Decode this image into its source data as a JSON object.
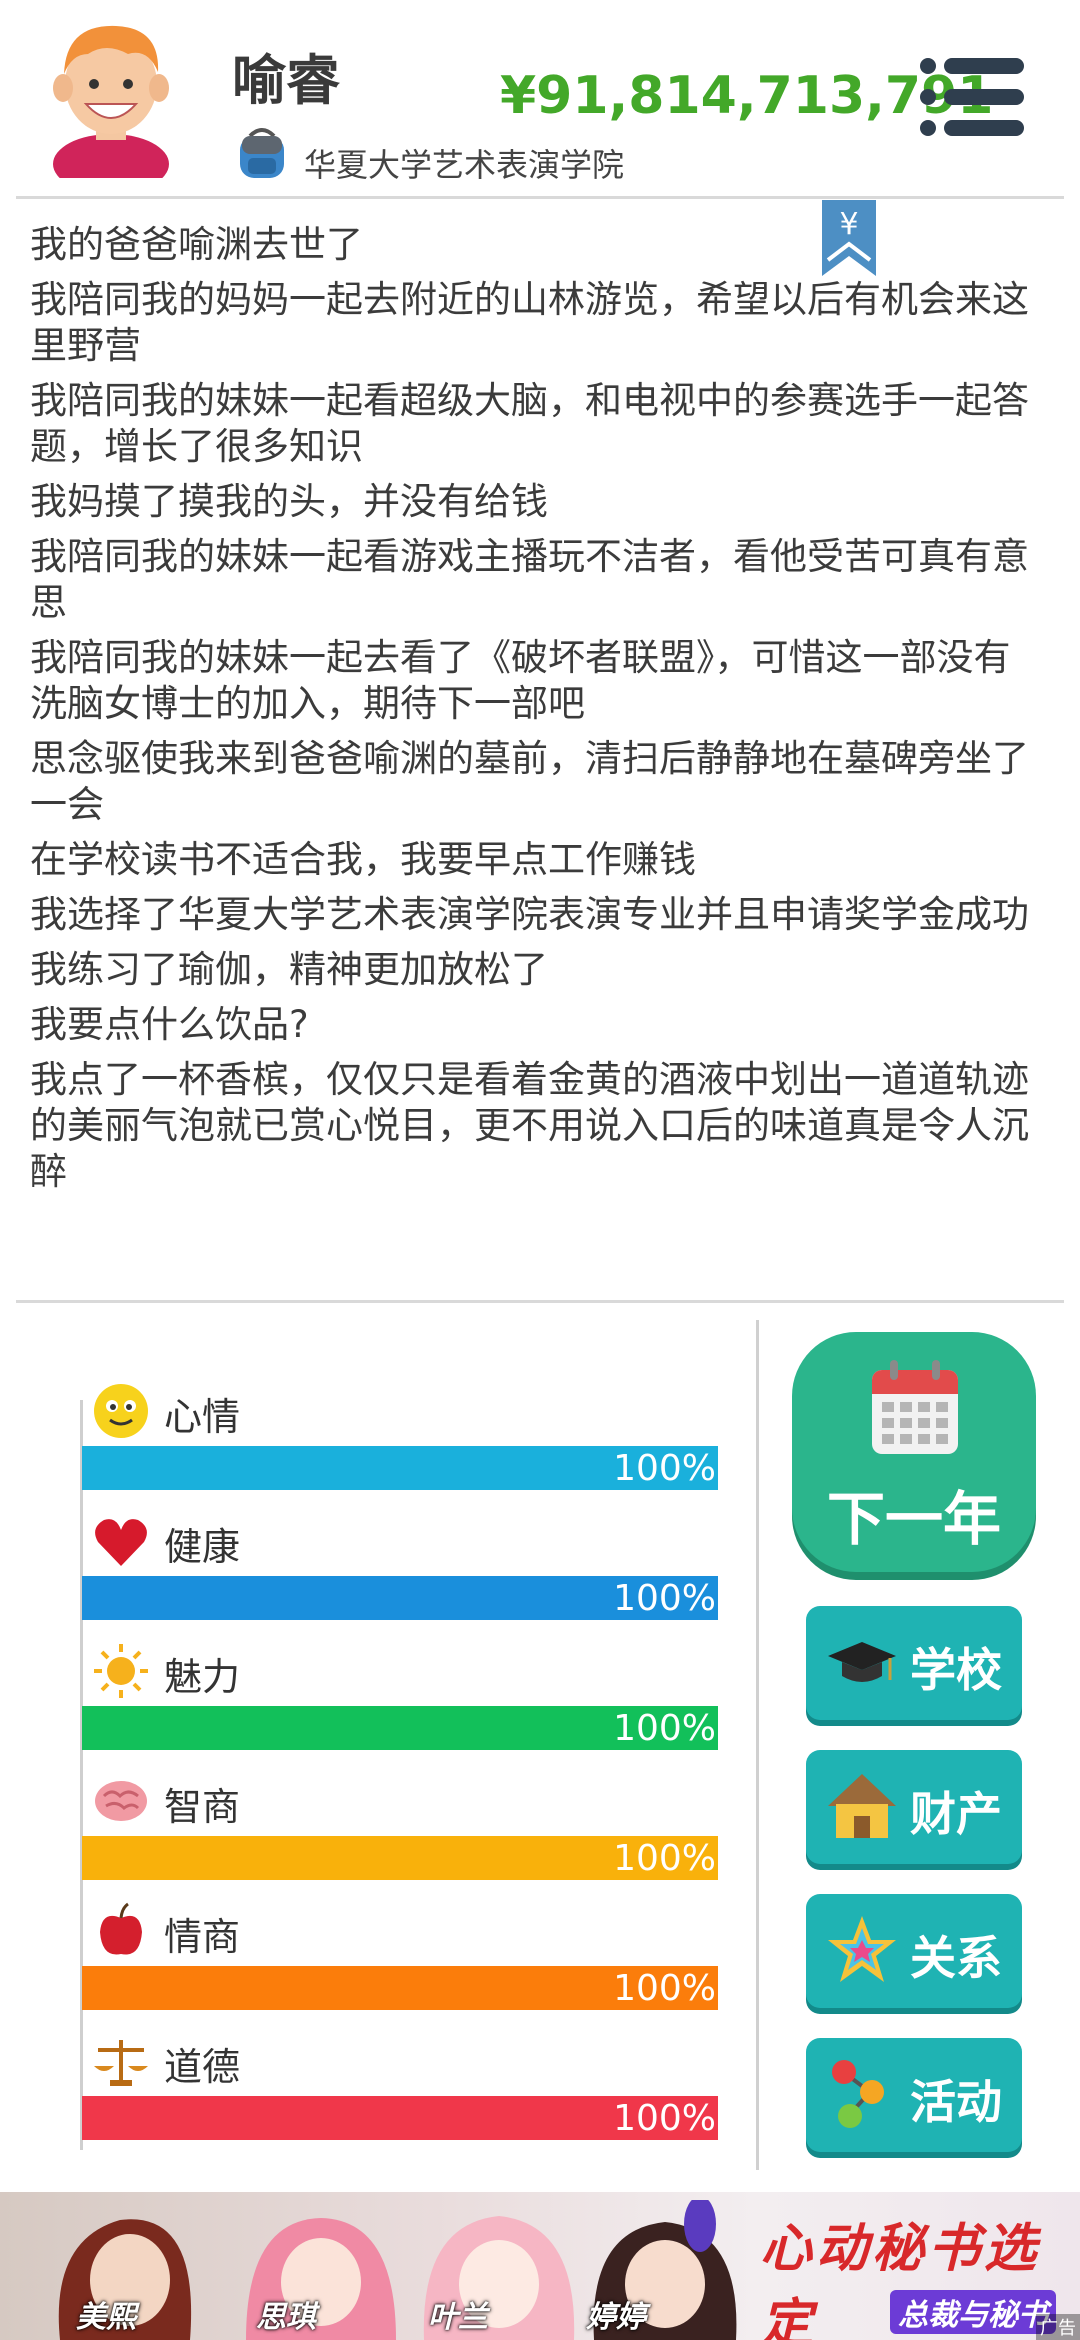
{
  "header": {
    "name": "喻睿",
    "school": "华夏大学艺术表演学院",
    "money": "¥91,814,713,791",
    "menu_icon": "hamburger-menu-icon",
    "avatar_icon": "boy-avatar",
    "school_icon": "backpack-icon"
  },
  "log": {
    "bookmark_symbol": "¥",
    "lines": [
      "我的爸爸喻渊去世了",
      "我陪同我的妈妈一起去附近的山林游览，希望以后有机会来这里野营",
      "我陪同我的妹妹一起看超级大脑，和电视中的参赛选手一起答题，增长了很多知识",
      "我妈摸了摸我的头，并没有给钱",
      "我陪同我的妹妹一起看游戏主播玩不洁者，看他受苦可真有意思",
      "我陪同我的妹妹一起去看了《破坏者联盟》，可惜这一部没有洗脑女博士的加入，期待下一部吧",
      "思念驱使我来到爸爸喻渊的墓前，清扫后静静地在墓碑旁坐了一会",
      "在学校读书不适合我，我要早点工作赚钱",
      "我选择了华夏大学艺术表演学院表演专业并且申请奖学金成功",
      "我练习了瑜伽，精神更加放松了",
      "我要点什么饮品?",
      "我点了一杯香槟，仅仅只是看着金黄的酒液中划出一道道轨迹的美丽气泡就已赏心悦目，更不用说入口后的味道真是令人沉醉"
    ]
  },
  "stats": [
    {
      "label": "心情",
      "value": 100,
      "display": "100%",
      "color": "#1ab0dc",
      "icon": "smiley-icon"
    },
    {
      "label": "健康",
      "value": 100,
      "display": "100%",
      "color": "#1a8fdc",
      "icon": "heart-icon"
    },
    {
      "label": "魅力",
      "value": 100,
      "display": "100%",
      "color": "#12c05a",
      "icon": "sun-icon"
    },
    {
      "label": "智商",
      "value": 100,
      "display": "100%",
      "color": "#f9b10b",
      "icon": "brain-icon"
    },
    {
      "label": "情商",
      "value": 100,
      "display": "100%",
      "color": "#fb7d0b",
      "icon": "apple-icon"
    },
    {
      "label": "道德",
      "value": 100,
      "display": "100%",
      "color": "#f0374a",
      "icon": "scales-icon"
    }
  ],
  "actions": {
    "next_year": "下一年",
    "buttons": [
      {
        "label": "学校",
        "icon": "graduation-cap-icon"
      },
      {
        "label": "财产",
        "icon": "house-icon"
      },
      {
        "label": "关系",
        "icon": "star-icon"
      },
      {
        "label": "活动",
        "icon": "activity-dots-icon"
      }
    ]
  },
  "banner": {
    "characters": [
      "美熙",
      "思琪",
      "叶兰",
      "婷婷"
    ],
    "slogan": "心动秘书选定",
    "sub": "总裁与秘书",
    "ad_tag": "广告"
  }
}
